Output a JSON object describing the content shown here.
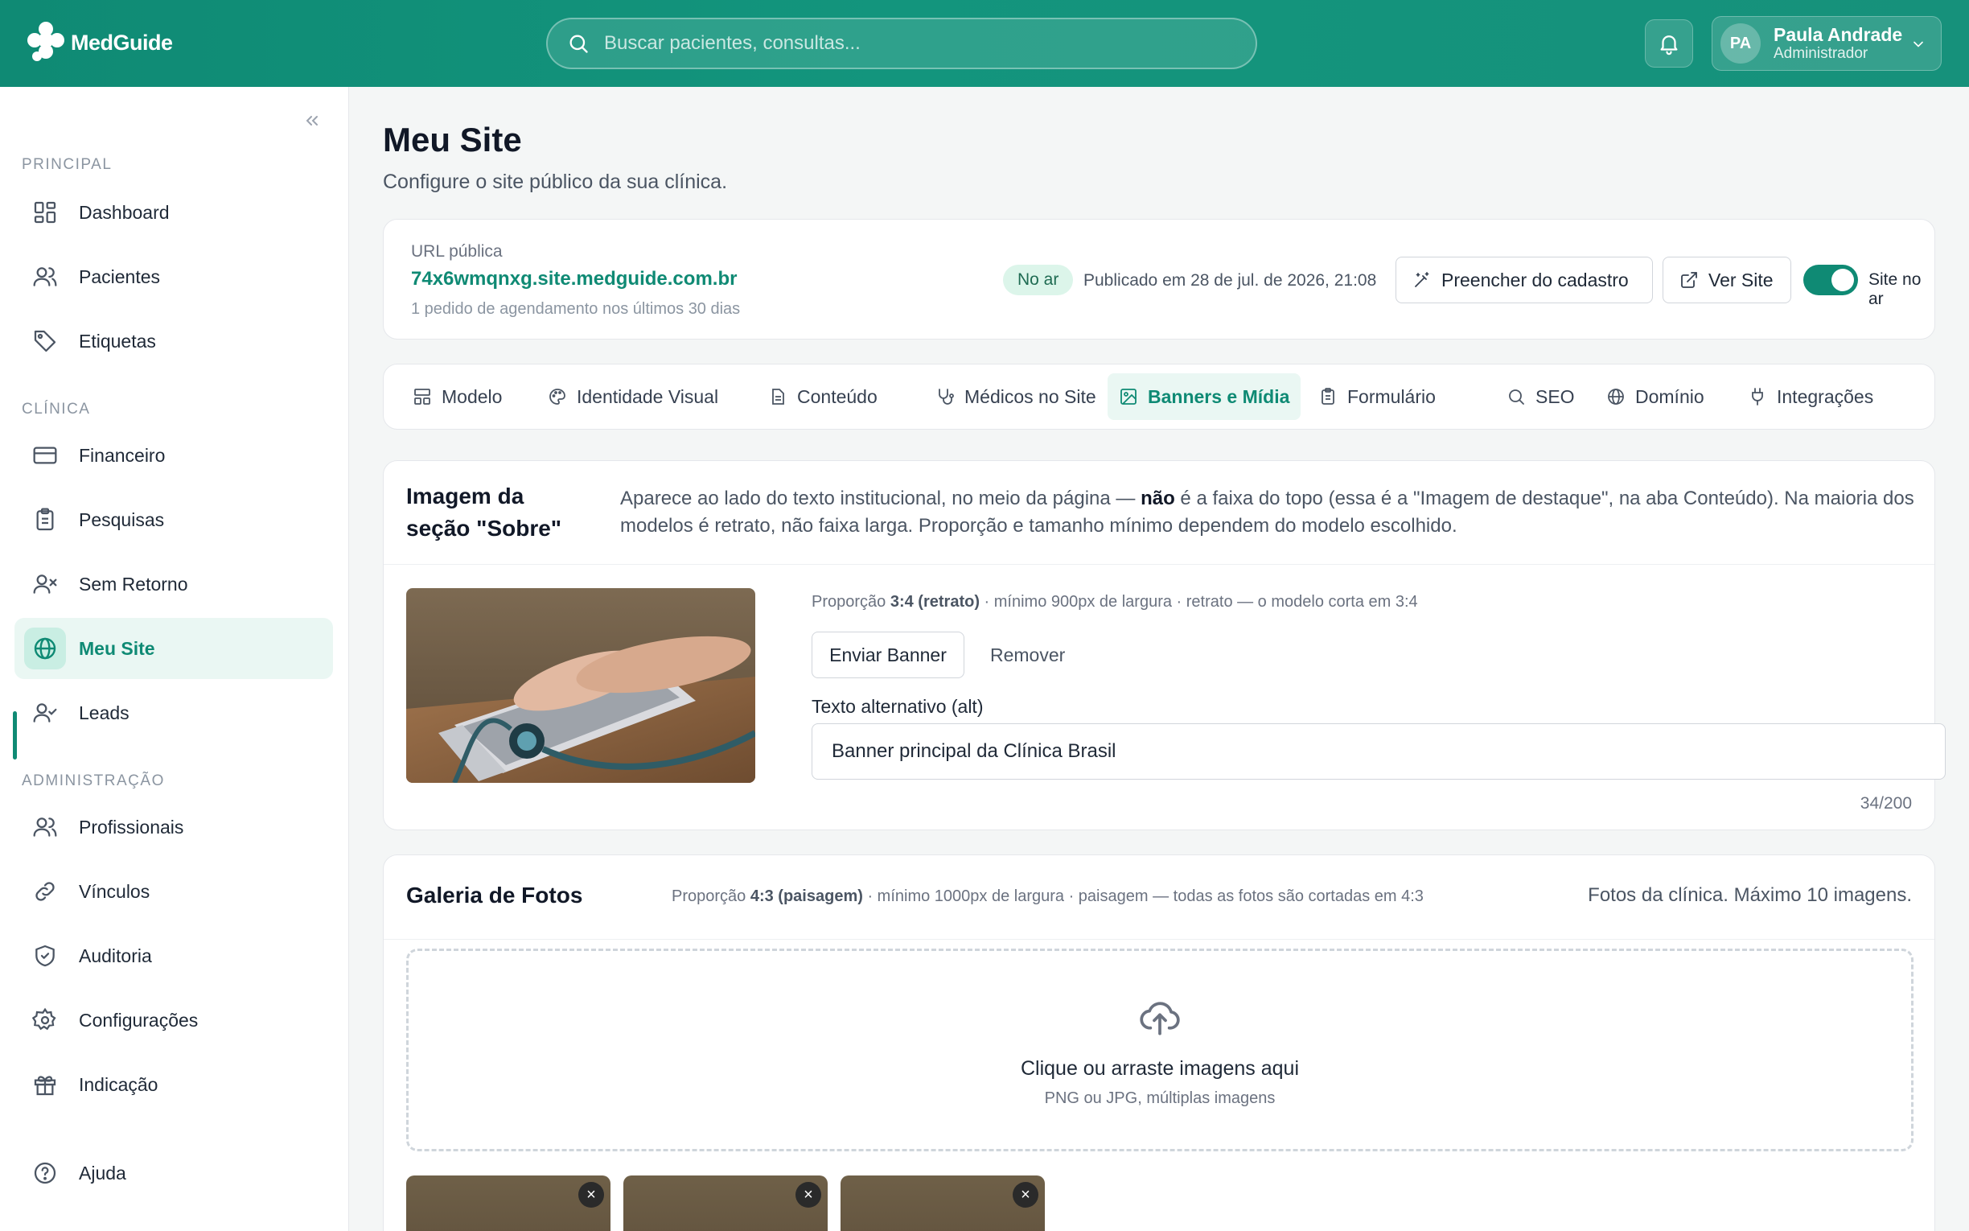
{
  "header": {
    "logo_text": "MedGuide",
    "search_placeholder": "Buscar pacientes, consultas...",
    "user": {
      "initials": "PA",
      "name": "Paula Andrade",
      "role": "Administrador"
    }
  },
  "sidebar": {
    "sections": {
      "principal": "PRINCIPAL",
      "clinica": "CLÍNICA",
      "administracao": "ADMINISTRAÇÃO"
    },
    "items": [
      {
        "label": "Dashboard"
      },
      {
        "label": "Pacientes"
      },
      {
        "label": "Etiquetas"
      },
      {
        "label": "Financeiro"
      },
      {
        "label": "Pesquisas"
      },
      {
        "label": "Sem Retorno"
      },
      {
        "label": "Meu Site"
      },
      {
        "label": "Leads"
      },
      {
        "label": "Profissionais"
      },
      {
        "label": "Vínculos"
      },
      {
        "label": "Auditoria"
      },
      {
        "label": "Configurações"
      },
      {
        "label": "Indicação"
      },
      {
        "label": "Ajuda"
      }
    ],
    "active_item": "Meu Site"
  },
  "page": {
    "title": "Meu Site",
    "subtitle": "Configure o site público da sua clínica."
  },
  "site_url": {
    "label": "URL pública",
    "url": "74x6wmqnxg.site.medguide.com.br",
    "note": "1 pedido de agendamento nos últimos 30 dias",
    "status_badge": "No ar",
    "published": "Publicado em 28 de jul. de 2026, 21:08",
    "fill_button": "Preencher do cadastro",
    "view_button": "Ver Site",
    "toggle_label": "Site no ar",
    "toggle_on": true
  },
  "tabs": [
    {
      "label": "Modelo"
    },
    {
      "label": "Identidade Visual"
    },
    {
      "label": "Conteúdo"
    },
    {
      "label": "Médicos no Site"
    },
    {
      "label": "Banners e Mídia"
    },
    {
      "label": "Formulário"
    },
    {
      "label": "SEO"
    },
    {
      "label": "Domínio"
    },
    {
      "label": "Integrações"
    }
  ],
  "active_tab": "Banners e Mídia",
  "about_section": {
    "title": "Imagem da seção \"Sobre\"",
    "desc_part1": "Aparece ao lado do texto institucional, no meio da página — ",
    "desc_bold": "não",
    "desc_part2": " é a faixa do topo (essa é a \"Imagem de destaque\", na aba Conteúdo). Na maioria dos modelos é retrato, não faixa larga. Proporção e tamanho mínimo dependem do modelo escolhido.",
    "meta_prefix": "Proporção ",
    "meta_bold": "3:4 (retrato)",
    "meta_suffix": " · mínimo 900px de largura · retrato — o modelo corta em 3:4",
    "upload_button": "Enviar Banner",
    "remove_link": "Remover",
    "alt_label": "Texto alternativo (alt)",
    "alt_value": "Banner principal da Clínica Brasil",
    "alt_count": "34/200"
  },
  "gallery": {
    "title": "Galeria de Fotos",
    "meta_prefix": "Proporção ",
    "meta_bold": "4:3 (paisagem)",
    "meta_suffix": " · mínimo 1000px de largura · paisagem — todas as fotos são cortadas em 4:3",
    "note": "Fotos da clínica. Máximo 10 imagens.",
    "dropzone_title": "Clique ou arraste imagens aqui",
    "dropzone_sub": "PNG ou JPG, múltiplas imagens",
    "remove_glyph": "×"
  },
  "colors": {
    "brand": "#0f8a74",
    "brand_light": "#eaf7f3",
    "badge_bg": "#dcf5ea"
  }
}
